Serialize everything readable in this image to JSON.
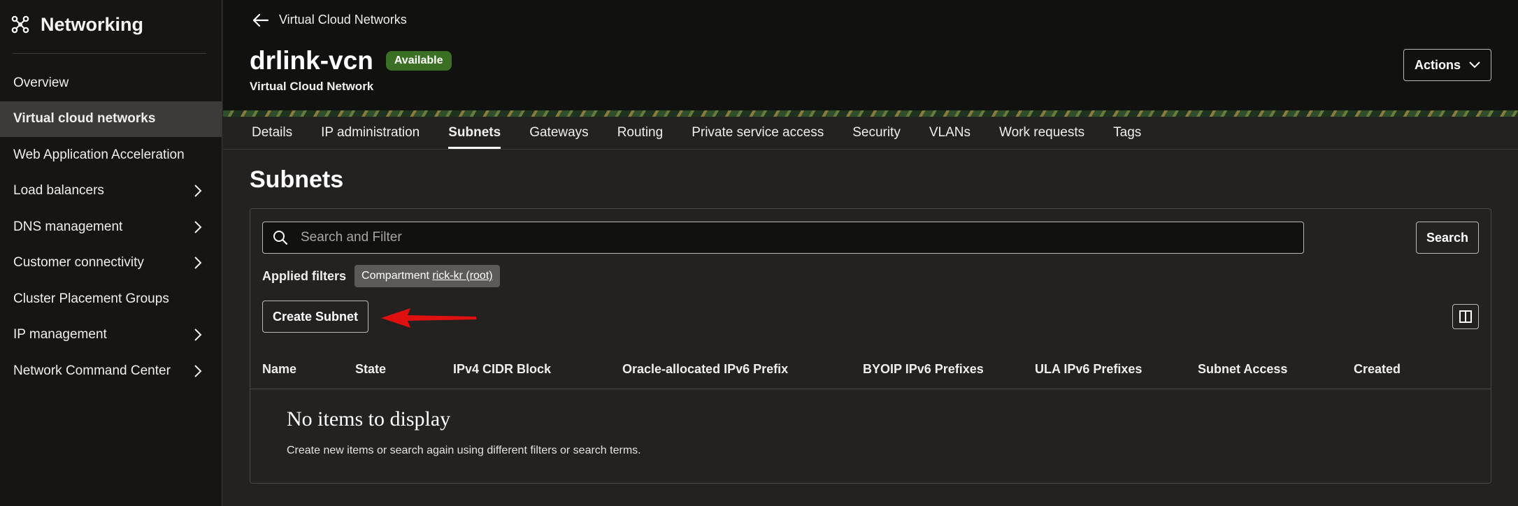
{
  "sidebar": {
    "title": "Networking",
    "items": [
      {
        "label": "Overview",
        "chevron": false,
        "active": false
      },
      {
        "label": "Virtual cloud networks",
        "chevron": false,
        "active": true
      },
      {
        "label": "Web Application Acceleration",
        "chevron": false,
        "active": false
      },
      {
        "label": "Load balancers",
        "chevron": true,
        "active": false
      },
      {
        "label": "DNS management",
        "chevron": true,
        "active": false
      },
      {
        "label": "Customer connectivity",
        "chevron": true,
        "active": false
      },
      {
        "label": "Cluster Placement Groups",
        "chevron": false,
        "active": false
      },
      {
        "label": "IP management",
        "chevron": true,
        "active": false
      },
      {
        "label": "Network Command Center",
        "chevron": true,
        "active": false
      }
    ]
  },
  "header": {
    "back_label": "Virtual Cloud Networks",
    "title": "drlink-vcn",
    "status": "Available",
    "subtitle": "Virtual Cloud Network",
    "actions_label": "Actions"
  },
  "tabs": [
    {
      "label": "Details",
      "active": false
    },
    {
      "label": "IP administration",
      "active": false
    },
    {
      "label": "Subnets",
      "active": true
    },
    {
      "label": "Gateways",
      "active": false
    },
    {
      "label": "Routing",
      "active": false
    },
    {
      "label": "Private service access",
      "active": false
    },
    {
      "label": "Security",
      "active": false
    },
    {
      "label": "VLANs",
      "active": false
    },
    {
      "label": "Work requests",
      "active": false
    },
    {
      "label": "Tags",
      "active": false
    }
  ],
  "subnets": {
    "title": "Subnets",
    "search_placeholder": "Search and Filter",
    "search_button": "Search",
    "filters_label": "Applied filters",
    "filter_chip_prefix": "Compartment",
    "filter_chip_value": "rick-kr (root)",
    "create_button": "Create Subnet",
    "columns": [
      "Name",
      "State",
      "IPv4 CIDR Block",
      "Oracle-allocated IPv6 Prefix",
      "BYOIP IPv6 Prefixes",
      "ULA IPv6 Prefixes",
      "Subnet Access",
      "Created"
    ],
    "empty_title": "No items to display",
    "empty_description": "Create new items or search again using different filters or search terms."
  },
  "colors": {
    "status_badge": "#3b6f23",
    "annotation_arrow": "#e01010"
  },
  "icons": {
    "brand": "networking-icon",
    "back": "arrow-left-icon",
    "search": "search-icon",
    "columns": "columns-icon",
    "chevron": "chevron-right-icon"
  }
}
